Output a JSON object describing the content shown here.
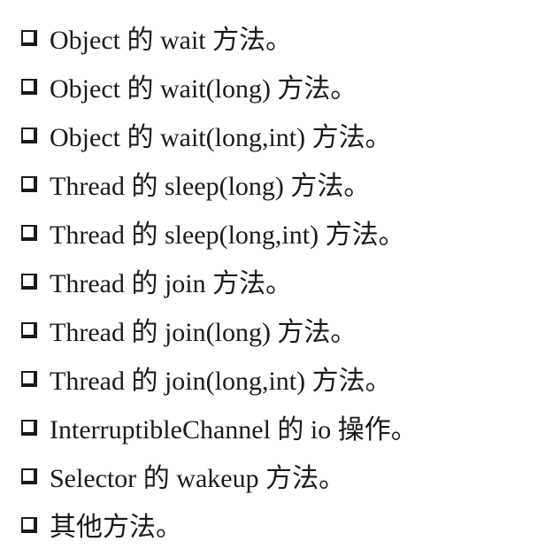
{
  "items": [
    "Object 的 wait 方法。",
    "Object 的 wait(long) 方法。",
    "Object 的 wait(long,int) 方法。",
    "Thread 的 sleep(long) 方法。",
    "Thread 的 sleep(long,int) 方法。",
    "Thread 的 join 方法。",
    "Thread 的 join(long) 方法。",
    "Thread 的 join(long,int) 方法。",
    "InterruptibleChannel 的 io 操作。",
    "Selector 的 wakeup 方法。",
    "其他方法。"
  ]
}
